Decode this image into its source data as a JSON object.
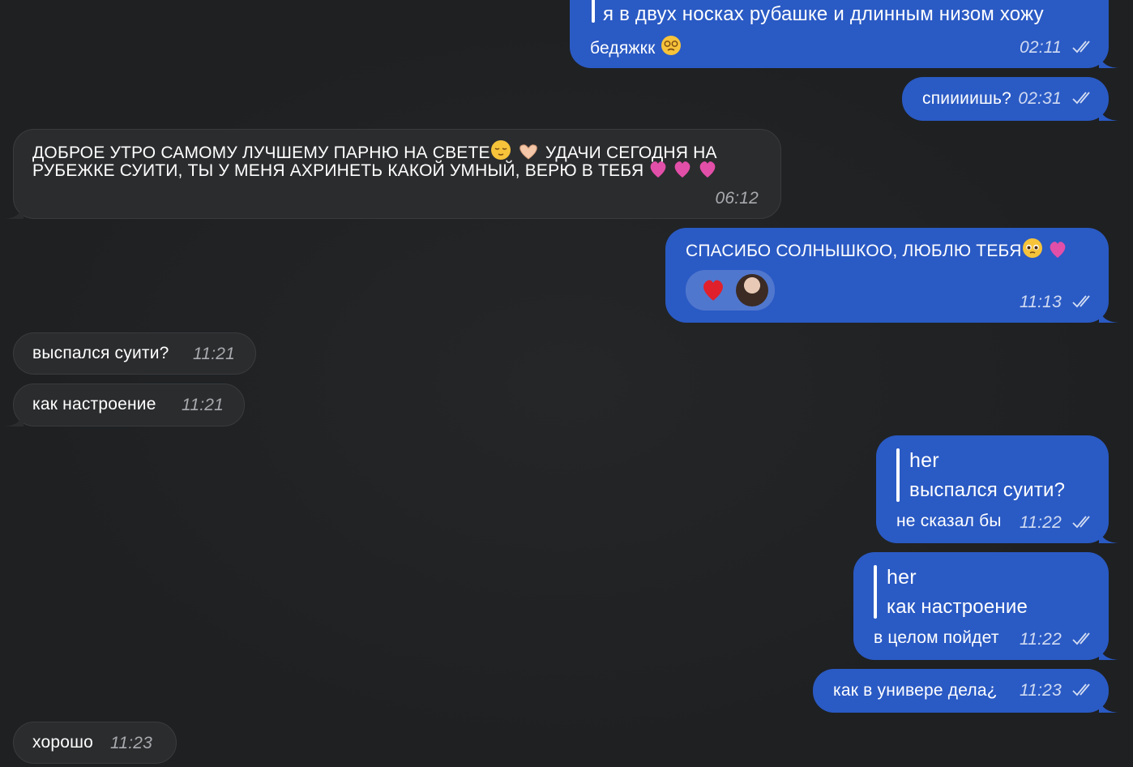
{
  "messages": [
    {
      "id": "m1",
      "side": "out",
      "quote_text": "я в двух носках рубашке и длинным низом хожу",
      "text": "бедяжкк",
      "emoji": "dizzy-face",
      "time": "02:11"
    },
    {
      "id": "m2",
      "side": "out",
      "text": "спиииишь?",
      "time": "02:31"
    },
    {
      "id": "m3",
      "side": "in",
      "line1": "ДОБРОЕ УТРО САМОМУ ЛУЧШЕМУ ПАРНЮ НА СВЕТЕ",
      "line1b": "УДАЧИ СЕГОДНЯ НА",
      "line2": "РУБЕЖКЕ СУИТИ, ТЫ У МЕНЯ АХРИНЕТЬ КАКОЙ УМНЫЙ, ВЕРЮ В ТЕБЯ",
      "time": "06:12"
    },
    {
      "id": "m4",
      "side": "out",
      "text": "СПАСИБО СОЛНЫШКОО, ЛЮБЛЮ ТЕБЯ",
      "reaction": "red-heart",
      "time": "11:13"
    },
    {
      "id": "m5",
      "side": "in",
      "text": "выспался суити?",
      "time": "11:21"
    },
    {
      "id": "m6",
      "side": "in",
      "text": "как настроение",
      "time": "11:21"
    },
    {
      "id": "m7",
      "side": "out",
      "reply_name": "her",
      "reply_text": "выспался суити?",
      "text": "не сказал бы",
      "time": "11:22"
    },
    {
      "id": "m8",
      "side": "out",
      "reply_name": "her",
      "reply_text": "как настроение",
      "text": "в целом пойдет",
      "time": "11:22"
    },
    {
      "id": "m9",
      "side": "out",
      "text": "как в универе дела¿",
      "time": "11:23"
    },
    {
      "id": "m10",
      "side": "in",
      "text": "хорошо",
      "time": "11:23"
    }
  ],
  "colors": {
    "outgoing": "#2a5ac4",
    "incoming": "#2b2c2e",
    "background": "#1f2123"
  }
}
